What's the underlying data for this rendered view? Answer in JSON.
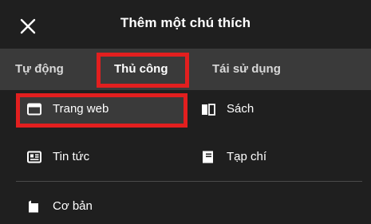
{
  "header": {
    "title": "Thêm một chú thích",
    "close_icon": "close-icon"
  },
  "tabs": [
    {
      "label": "Tự động",
      "active": false
    },
    {
      "label": "Thủ công",
      "active": true
    },
    {
      "label": "Tái sử dụng",
      "active": false
    }
  ],
  "items": {
    "webpage": {
      "label": "Trang web",
      "icon": "browser-window-icon",
      "selected": true
    },
    "book": {
      "label": "Sách",
      "icon": "book-icon"
    },
    "news": {
      "label": "Tin tức",
      "icon": "newspaper-icon"
    },
    "magazine": {
      "label": "Tạp chí",
      "icon": "journal-icon"
    },
    "basic": {
      "label": "Cơ bản",
      "icon": "bookmark-icon"
    }
  },
  "colors": {
    "background": "#1f1f1f",
    "tab_bar": "#3a3a3a",
    "highlight": "#e21f1f",
    "text": "#ffffff"
  }
}
